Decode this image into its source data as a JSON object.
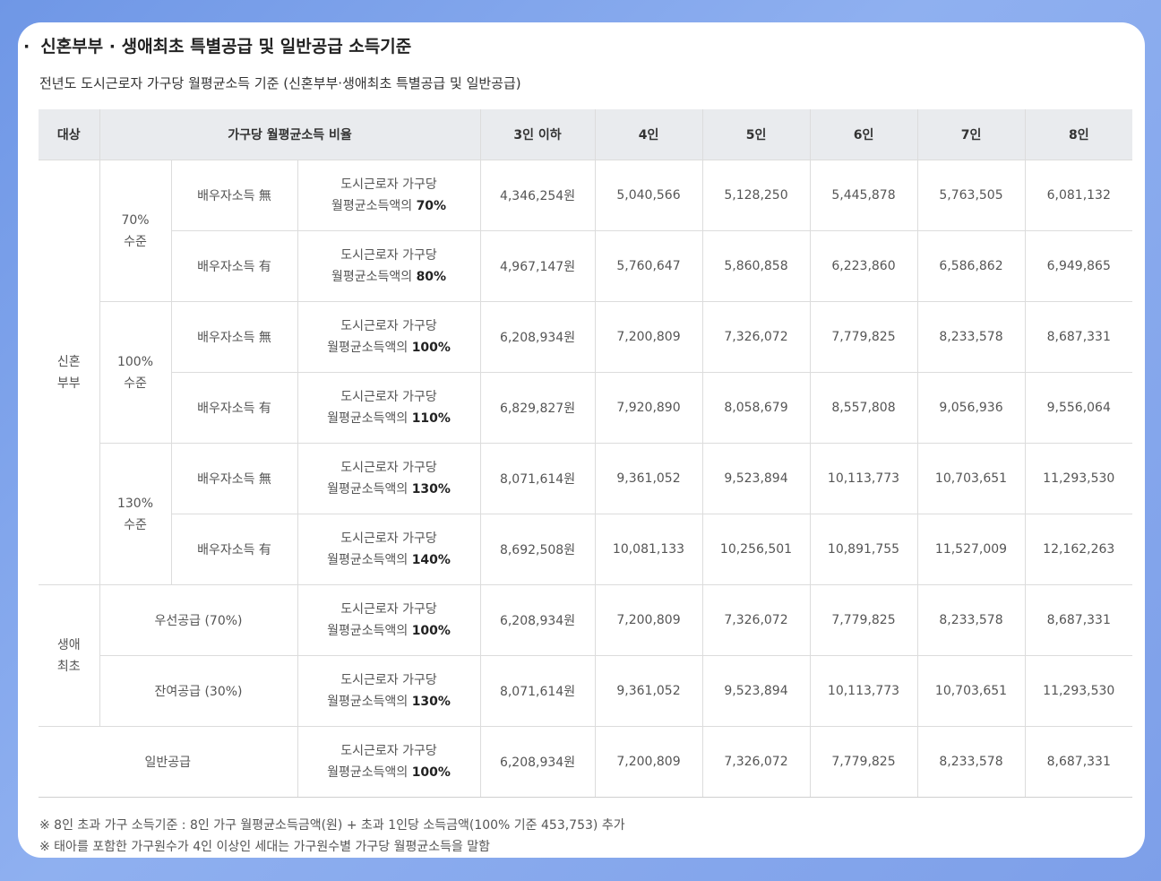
{
  "title": "신혼부부 · 생애최초 특별공급 및 일반공급 소득기준",
  "subtitle": "전년도 도시근로자 가구당 월평균소득 기준 (신혼부부·생애최초 특별공급 및 일반공급)",
  "table": {
    "headers": [
      "대상",
      "가구당 월평균소득 비율",
      "3인 이하",
      "4인",
      "5인",
      "6인",
      "7인",
      "8인"
    ],
    "basis_line1": "도시근로자 가구당",
    "basis_prefix": "월평균소득액의 ",
    "groups": [
      {
        "line1": "신혼",
        "line2": "부부"
      },
      {
        "line1": "생애",
        "line2": "최초"
      }
    ],
    "levels": [
      {
        "line1": "70%",
        "line2": "수준"
      },
      {
        "line1": "100%",
        "line2": "수준"
      },
      {
        "line1": "130%",
        "line2": "수준"
      }
    ],
    "rows": [
      {
        "spouse": "배우자소득 無",
        "pct": "70%",
        "v": [
          "4,346,254원",
          "5,040,566",
          "5,128,250",
          "5,445,878",
          "5,763,505",
          "6,081,132"
        ]
      },
      {
        "spouse": "배우자소득 有",
        "pct": "80%",
        "v": [
          "4,967,147원",
          "5,760,647",
          "5,860,858",
          "6,223,860",
          "6,586,862",
          "6,949,865"
        ]
      },
      {
        "spouse": "배우자소득 無",
        "pct": "100%",
        "v": [
          "6,208,934원",
          "7,200,809",
          "7,326,072",
          "7,779,825",
          "8,233,578",
          "8,687,331"
        ]
      },
      {
        "spouse": "배우자소득 有",
        "pct": "110%",
        "v": [
          "6,829,827원",
          "7,920,890",
          "8,058,679",
          "8,557,808",
          "9,056,936",
          "9,556,064"
        ]
      },
      {
        "spouse": "배우자소득 無",
        "pct": "130%",
        "v": [
          "8,071,614원",
          "9,361,052",
          "9,523,894",
          "10,113,773",
          "10,703,651",
          "11,293,530"
        ]
      },
      {
        "spouse": "배우자소득 有",
        "pct": "140%",
        "v": [
          "8,692,508원",
          "10,081,133",
          "10,256,501",
          "10,891,755",
          "11,527,009",
          "12,162,263"
        ]
      },
      {
        "label": "우선공급 (70%)",
        "pct": "100%",
        "v": [
          "6,208,934원",
          "7,200,809",
          "7,326,072",
          "7,779,825",
          "8,233,578",
          "8,687,331"
        ]
      },
      {
        "label": "잔여공급 (30%)",
        "pct": "130%",
        "v": [
          "8,071,614원",
          "9,361,052",
          "9,523,894",
          "10,113,773",
          "10,703,651",
          "11,293,530"
        ]
      },
      {
        "label": "일반공급",
        "pct": "100%",
        "v": [
          "6,208,934원",
          "7,200,809",
          "7,326,072",
          "7,779,825",
          "8,233,578",
          "8,687,331"
        ]
      }
    ]
  },
  "notes": [
    "※ 8인 초과 가구 소득기준 : 8인 가구 월평균소득금액(원) + 초과 1인당 소득금액(100% 기준 453,753) 추가",
    "※ 태아를 포함한 가구원수가 4인 이상인 세대는 가구원수별 가구당 월평균소득을 말함"
  ]
}
